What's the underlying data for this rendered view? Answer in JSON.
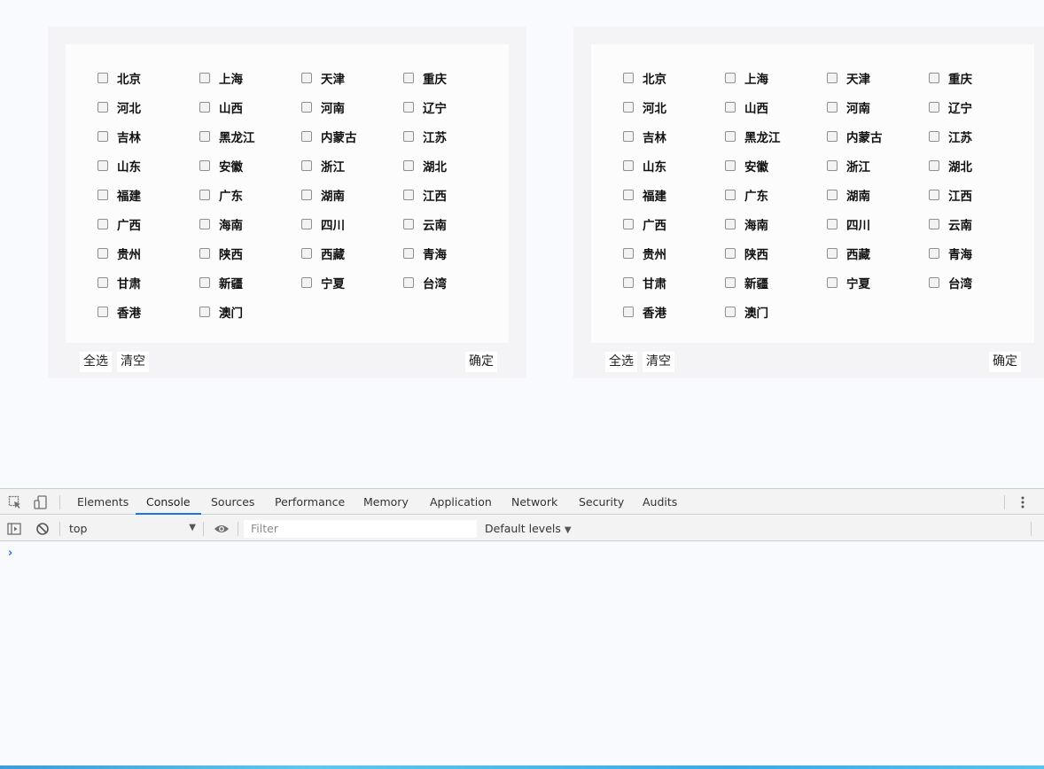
{
  "pickers": [
    {
      "provinces": [
        "北京",
        "上海",
        "天津",
        "重庆",
        "河北",
        "山西",
        "河南",
        "辽宁",
        "吉林",
        "黑龙江",
        "内蒙古",
        "江苏",
        "山东",
        "安徽",
        "浙江",
        "湖北",
        "福建",
        "广东",
        "湖南",
        "江西",
        "广西",
        "海南",
        "四川",
        "云南",
        "贵州",
        "陕西",
        "西藏",
        "青海",
        "甘肃",
        "新疆",
        "宁夏",
        "台湾",
        "香港",
        "澳门"
      ],
      "select_all": "全选",
      "clear": "清空",
      "confirm": "确定"
    },
    {
      "provinces": [
        "北京",
        "上海",
        "天津",
        "重庆",
        "河北",
        "山西",
        "河南",
        "辽宁",
        "吉林",
        "黑龙江",
        "内蒙古",
        "江苏",
        "山东",
        "安徽",
        "浙江",
        "湖北",
        "福建",
        "广东",
        "湖南",
        "江西",
        "广西",
        "海南",
        "四川",
        "云南",
        "贵州",
        "陕西",
        "西藏",
        "青海",
        "甘肃",
        "新疆",
        "宁夏",
        "台湾",
        "香港",
        "澳门"
      ],
      "select_all": "全选",
      "clear": "清空",
      "confirm": "确定"
    }
  ],
  "devtools": {
    "tabs": [
      "Elements",
      "Console",
      "Sources",
      "Performance",
      "Memory",
      "Application",
      "Network",
      "Security",
      "Audits"
    ],
    "active_tab": "Console",
    "context": "top",
    "filter_placeholder": "Filter",
    "levels": "Default levels",
    "prompt": "›",
    "icons": [
      "inspect-element-icon",
      "device-toolbar-icon",
      "more-vert-icon",
      "sidebar-toggle-icon",
      "clear-console-icon",
      "eye-icon",
      "chevron-down-icon"
    ],
    "accent": "#1a73e8"
  }
}
